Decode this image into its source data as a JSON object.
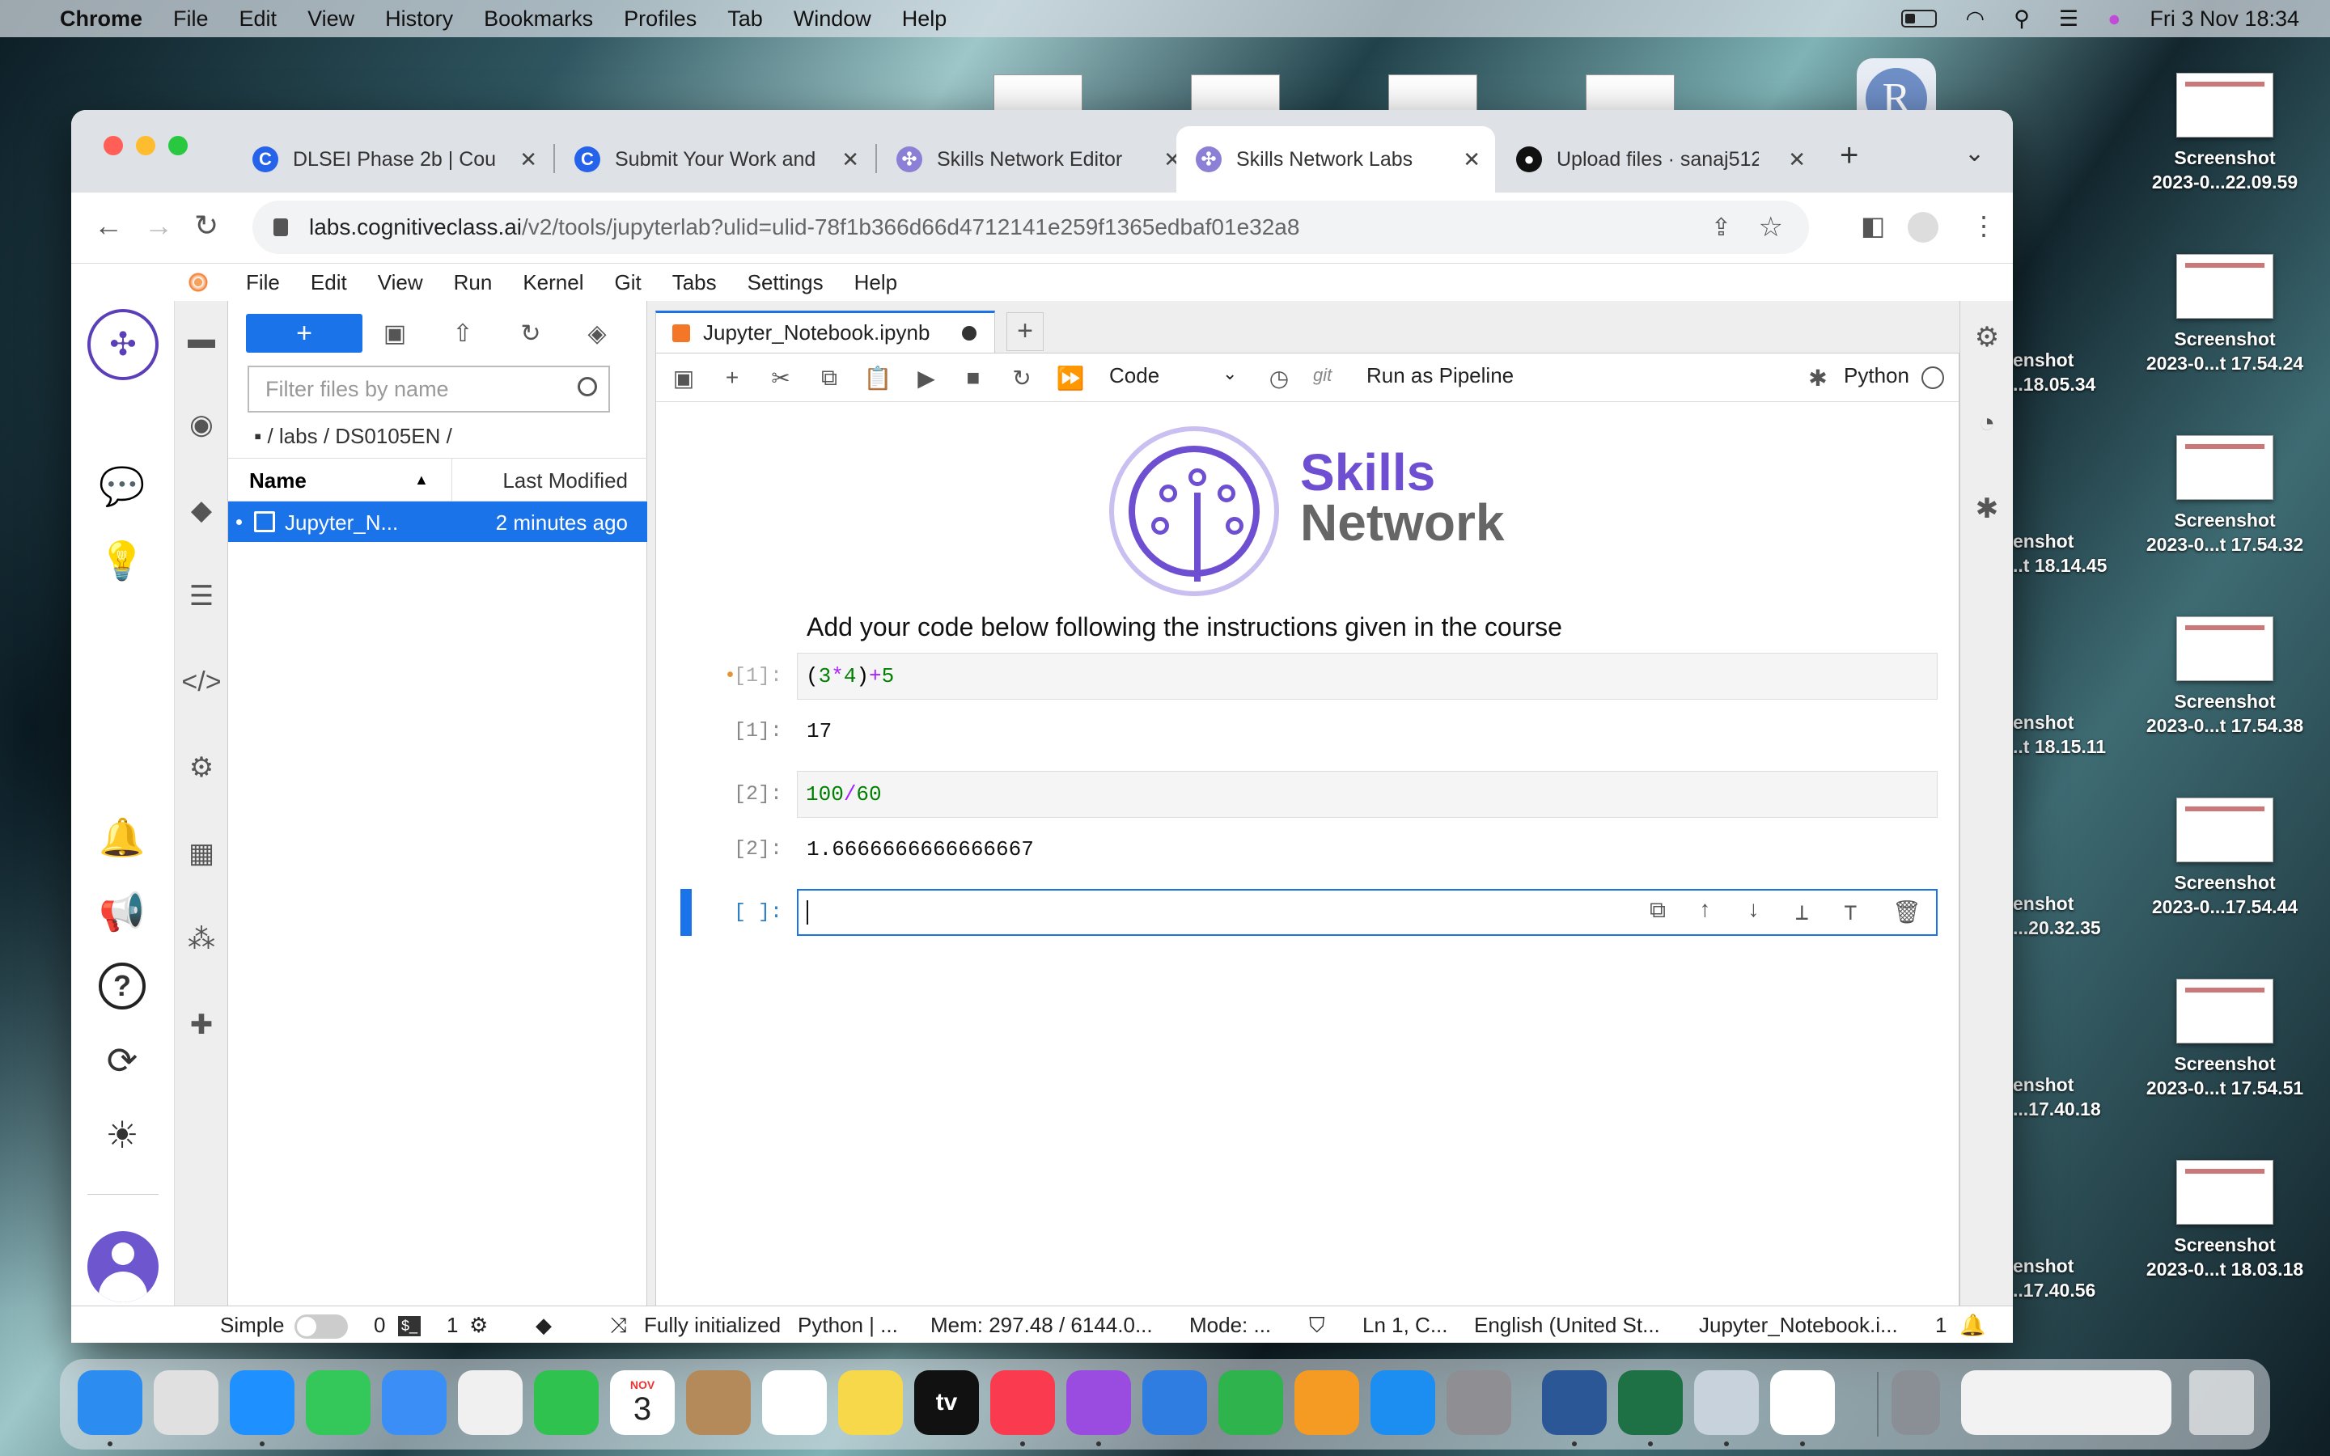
{
  "menubar": {
    "app": "Chrome",
    "items": [
      "File",
      "Edit",
      "View",
      "History",
      "Bookmarks",
      "Profiles",
      "Tab",
      "Window",
      "Help"
    ],
    "datetime": "Fri 3 Nov  18:34"
  },
  "desktop": {
    "files": [
      {
        "name": "Screenshot",
        "sub": "2023-0...22.09.59"
      },
      {
        "name": "Screenshot",
        "sub": "2023-0...t 17.54.24"
      },
      {
        "name": "Screenshot",
        "sub": "2023-0...t 17.54.32"
      },
      {
        "name": "Screenshot",
        "sub": "2023-0...t 17.54.38"
      },
      {
        "name": "Screenshot",
        "sub": "2023-0...17.54.44"
      },
      {
        "name": "Screenshot",
        "sub": "2023-0...t 17.54.51"
      },
      {
        "name": "Screenshot",
        "sub": "2023-0...t 18.03.18"
      }
    ],
    "partial": [
      {
        "name": "enshot",
        "sub": "..18.05.34"
      },
      {
        "name": "enshot",
        "sub": "..t 18.14.45"
      },
      {
        "name": "enshot",
        "sub": "..t 18.15.11"
      },
      {
        "name": "enshot",
        "sub": "...20.32.35"
      },
      {
        "name": "enshot",
        "sub": "...17.40.18"
      },
      {
        "name": "enshot",
        "sub": "..17.40.56"
      }
    ],
    "r_avatar": "R"
  },
  "browser": {
    "tabs": [
      {
        "title": "DLSEI Phase 2b | Cour",
        "favicon": "C",
        "color": "#2563eb"
      },
      {
        "title": "Submit Your Work and",
        "favicon": "C",
        "color": "#2563eb"
      },
      {
        "title": "Skills Network Editor",
        "favicon": "✣",
        "color": "#8b7fd6"
      },
      {
        "title": "Skills Network Labs",
        "favicon": "✣",
        "color": "#8b7fd6"
      },
      {
        "title": "Upload files · sanaj512",
        "favicon": "●",
        "color": "#111111"
      }
    ],
    "url_host": "labs.cognitiveclass.ai",
    "url_path": "/v2/tools/jupyterlab?ulid=ulid-78f1b366d66d4712141e259f1365edbaf01e32a8"
  },
  "jupyter": {
    "menu": [
      "File",
      "Edit",
      "View",
      "Run",
      "Kernel",
      "Git",
      "Tabs",
      "Settings",
      "Help"
    ],
    "filter_placeholder": "Filter files by name",
    "breadcrumb": "/ labs / DS0105EN /",
    "col_name": "Name",
    "col_modified": "Last Modified",
    "file": {
      "name": "Jupyter_N...",
      "modified": "2 minutes ago"
    },
    "doc_tab": "Jupyter_Notebook.ipynb",
    "cell_type": "Code",
    "git_label": "git",
    "pipeline": "Run as Pipeline",
    "kernel": "Python",
    "logo_line1": "Skills",
    "logo_line2": "Network",
    "markdown": "Add your code below following the instructions given in the course",
    "cells": [
      {
        "in_prompt": "[1]:",
        "out_prompt": "[1]:",
        "output": "17"
      },
      {
        "in_prompt": "[2]:",
        "out_prompt": "[2]:",
        "output": "1.6666666666666667"
      },
      {
        "in_prompt": "[ ]:"
      }
    ],
    "code1": {
      "p1": "(",
      "n1": "3",
      "op1": "*",
      "n2": "4",
      "p2": ")",
      "op2": "+",
      "n3": "5"
    },
    "code2": {
      "n1": "100",
      "op": "/",
      "n2": "60"
    },
    "modified_marker": "•"
  },
  "statusbar": {
    "mode": "Simple",
    "count1": "0",
    "count2": "1",
    "init": "Fully initialized",
    "kernel": "Python | ...",
    "mem": "Mem: 297.48 / 6144.0...",
    "modeinfo": "Mode: ...",
    "lncol": "Ln 1, C...",
    "lang": "English (United St...",
    "file": "Jupyter_Notebook.i...",
    "count3": "1"
  },
  "dock": {
    "apps": [
      {
        "name": "finder",
        "color": "#2d8cf0"
      },
      {
        "name": "launchpad",
        "color": "#e0e0e0"
      },
      {
        "name": "safari",
        "color": "#1e90ff"
      },
      {
        "name": "messages",
        "color": "#34c759"
      },
      {
        "name": "mail",
        "color": "#3a8ef6"
      },
      {
        "name": "photos",
        "color": "#f0f0f0"
      },
      {
        "name": "facetime",
        "color": "#30c24e"
      },
      {
        "name": "calendar",
        "color": "#ffffff"
      },
      {
        "name": "contacts",
        "color": "#b48a5a"
      },
      {
        "name": "reminders",
        "color": "#ffffff"
      },
      {
        "name": "notes",
        "color": "#f7d84a"
      },
      {
        "name": "tv",
        "color": "#111111"
      },
      {
        "name": "music",
        "color": "#fa3b4f"
      },
      {
        "name": "podcasts",
        "color": "#9b4ce0"
      },
      {
        "name": "keynote",
        "color": "#2f7de1"
      },
      {
        "name": "numbers",
        "color": "#2fb34c"
      },
      {
        "name": "pages",
        "color": "#f59a23"
      },
      {
        "name": "app-store",
        "color": "#1c8ef2"
      },
      {
        "name": "system-preferences",
        "color": "#8e8e93"
      },
      {
        "name": "word",
        "color": "#2b5797"
      },
      {
        "name": "excel",
        "color": "#1e7145"
      },
      {
        "name": "preview",
        "color": "#c7d2dc"
      },
      {
        "name": "chrome",
        "color": "#ffffff"
      }
    ],
    "calendar_month": "NOV",
    "calendar_day": "3",
    "tv_label": "tv"
  }
}
